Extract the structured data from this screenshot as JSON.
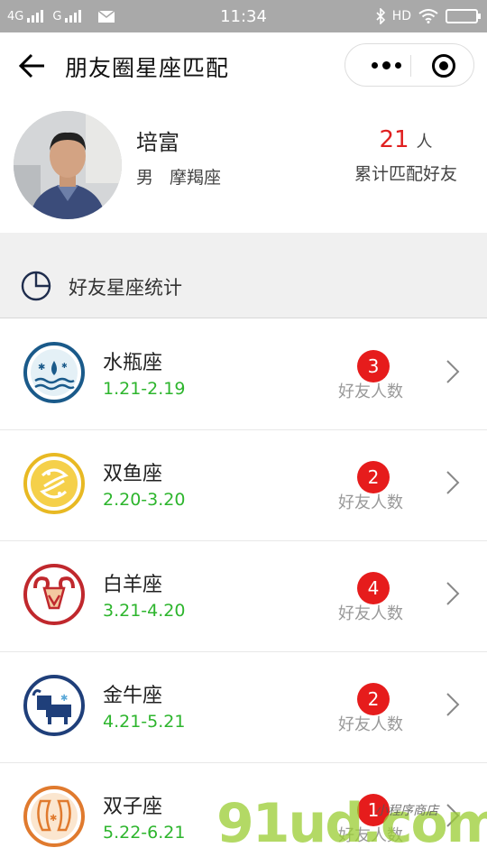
{
  "status_bar": {
    "network_left": "4G",
    "network_right": "G",
    "time": "11:34",
    "hd": "HD"
  },
  "navbar": {
    "title": "朋友圈星座匹配"
  },
  "profile": {
    "name": "培富",
    "gender": "男",
    "sign": "摩羯座",
    "match_count": "21",
    "match_unit": "人",
    "match_label": "累计匹配好友"
  },
  "section": {
    "title": "好友星座统计"
  },
  "zodiac_list": [
    {
      "name": "水瓶座",
      "dates": "1.21-2.19",
      "count": "3",
      "count_label": "好友人数",
      "icon": "aquarius-icon",
      "color": "#1a5a8a"
    },
    {
      "name": "双鱼座",
      "dates": "2.20-3.20",
      "count": "2",
      "count_label": "好友人数",
      "icon": "pisces-icon",
      "color": "#e8b923"
    },
    {
      "name": "白羊座",
      "dates": "3.21-4.20",
      "count": "4",
      "count_label": "好友人数",
      "icon": "aries-icon",
      "color": "#c0282d"
    },
    {
      "name": "金牛座",
      "dates": "4.21-5.21",
      "count": "2",
      "count_label": "好友人数",
      "icon": "taurus-icon",
      "color": "#1f3f7a"
    },
    {
      "name": "双子座",
      "dates": "5.22-6.21",
      "count": "1",
      "count_label": "好友人数",
      "icon": "gemini-icon",
      "color": "#e07a2e"
    }
  ],
  "watermark": {
    "main": "91ud.com",
    "sub": "小程序商店"
  },
  "colors": {
    "accent_red": "#e61c1c",
    "date_green": "#2db52d",
    "status_bar": "#a9a9a9"
  }
}
